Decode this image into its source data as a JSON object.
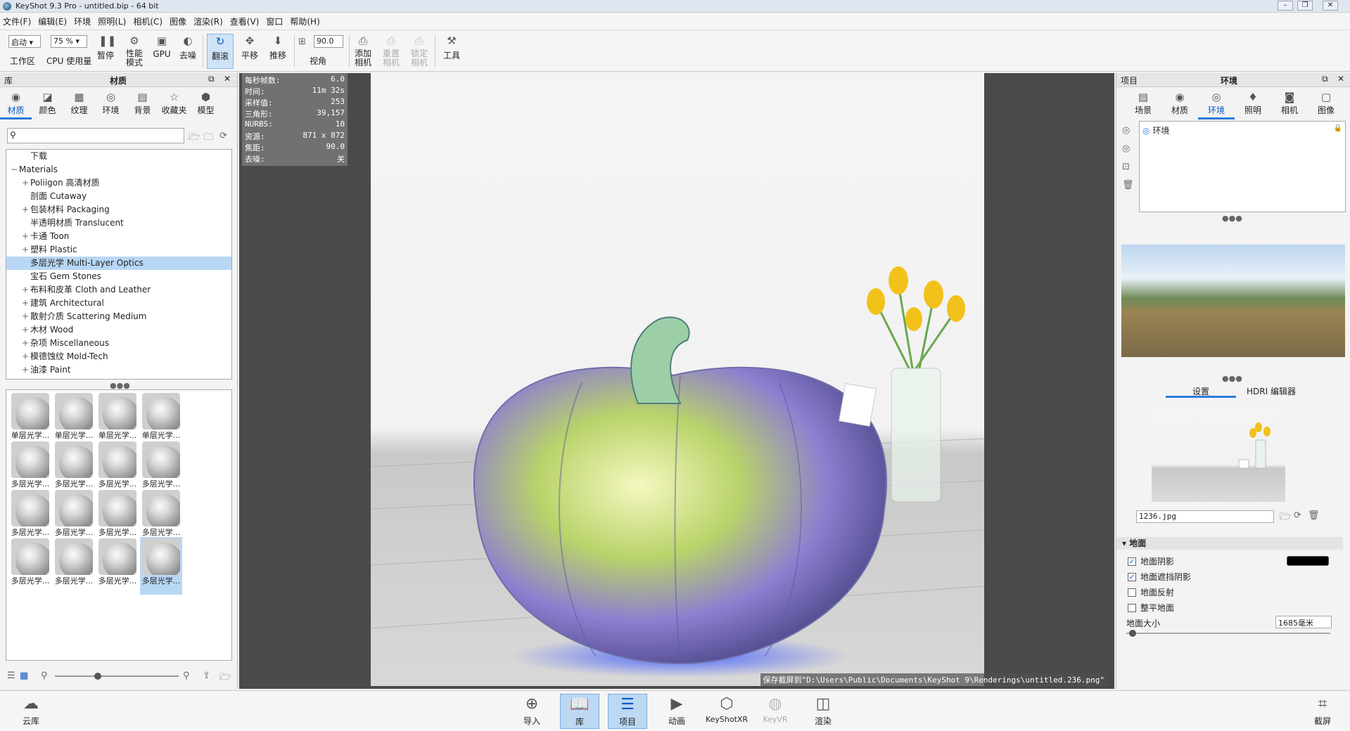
{
  "window": {
    "title": "KeyShot 9.3 Pro  - untitled.bip  - 64 bit"
  },
  "menu": [
    "文件(F)",
    "编辑(E)",
    "环境",
    "照明(L)",
    "相机(C)",
    "图像",
    "渲染(R)",
    "查看(V)",
    "窗口",
    "帮助(H)"
  ],
  "toolbar": {
    "workspace_value": "启动",
    "workspace_label": "工作区",
    "cpu_value": "75 %",
    "cpu_label": "CPU 使用量",
    "pause_label": "暂停",
    "perf_label": "性能\n模式",
    "gpu_label": "GPU",
    "denoise_label": "去噪",
    "tumble_label": "翻滚",
    "pan_label": "平移",
    "dolly_label": "推移",
    "fov_value": "90.0",
    "fov_label": "视角",
    "add_camera_label": "添加\n相机",
    "reset_camera_label": "重置\n相机",
    "lock_camera_label": "锁定\n相机",
    "tools_label": "工具"
  },
  "library": {
    "header_left": "库",
    "header_title": "材质",
    "tabs": [
      {
        "label": "材质",
        "icon": "material-icon"
      },
      {
        "label": "颜色",
        "icon": "color-icon"
      },
      {
        "label": "纹理",
        "icon": "texture-icon"
      },
      {
        "label": "环境",
        "icon": "environment-icon"
      },
      {
        "label": "背景",
        "icon": "background-icon"
      },
      {
        "label": "收藏夹",
        "icon": "favorites-icon"
      },
      {
        "label": "模型",
        "icon": "model-icon"
      }
    ],
    "tree": [
      {
        "label": "下载",
        "indent": 1,
        "exp": ""
      },
      {
        "label": "Materials",
        "indent": 0,
        "exp": "−"
      },
      {
        "label": "Poliigon 高清材质",
        "indent": 1,
        "exp": "+"
      },
      {
        "label": "剖面 Cutaway",
        "indent": 1,
        "exp": ""
      },
      {
        "label": "包装材料 Packaging",
        "indent": 1,
        "exp": "+"
      },
      {
        "label": "半透明材质 Translucent",
        "indent": 1,
        "exp": ""
      },
      {
        "label": "卡通 Toon",
        "indent": 1,
        "exp": "+"
      },
      {
        "label": "塑料 Plastic",
        "indent": 1,
        "exp": "+"
      },
      {
        "label": "多层光学 Multi-Layer Optics",
        "indent": 1,
        "exp": "",
        "selected": true
      },
      {
        "label": "宝石 Gem Stones",
        "indent": 1,
        "exp": ""
      },
      {
        "label": "布料和皮革 Cloth and Leather",
        "indent": 1,
        "exp": "+"
      },
      {
        "label": "建筑 Architectural",
        "indent": 1,
        "exp": "+"
      },
      {
        "label": "散射介质 Scattering Medium",
        "indent": 1,
        "exp": "+"
      },
      {
        "label": "木材 Wood",
        "indent": 1,
        "exp": "+"
      },
      {
        "label": "杂项 Miscellaneous",
        "indent": 1,
        "exp": "+"
      },
      {
        "label": "模德蚀纹 Mold-Tech",
        "indent": 1,
        "exp": "+"
      },
      {
        "label": "油漆 Paint",
        "indent": 1,
        "exp": "+"
      }
    ],
    "thumbs": [
      "单层光学...",
      "单层光学...",
      "单层光学...",
      "单层光学...",
      "多层光学...",
      "多层光学...",
      "多层光学...",
      "多层光学...",
      "多层光学...",
      "多层光学...",
      "多层光学...",
      "多层光学...",
      "多层光学...",
      "多层光学...",
      "多层光学...",
      "多层光学..."
    ]
  },
  "stats": [
    {
      "k": "每秒帧数:",
      "v": "6.0"
    },
    {
      "k": "时间:",
      "v": "11m 32s"
    },
    {
      "k": "采样值:",
      "v": "253"
    },
    {
      "k": "三角形:",
      "v": "39,157"
    },
    {
      "k": "NURBS:",
      "v": "10"
    },
    {
      "k": "资源:",
      "v": "871 x 872"
    },
    {
      "k": "焦距:",
      "v": "90.0"
    },
    {
      "k": "去噪:",
      "v": "关"
    }
  ],
  "viewport": {
    "save_message": "保存截屏到\"D:\\Users\\Public\\Documents\\KeyShot 9\\Renderings\\untitled.236.png\""
  },
  "project": {
    "header_left": "项目",
    "header_title": "环境",
    "tabs": [
      {
        "label": "场景",
        "icon": "scene-icon"
      },
      {
        "label": "材质",
        "icon": "material-icon"
      },
      {
        "label": "环境",
        "icon": "environment-icon"
      },
      {
        "label": "照明",
        "icon": "lighting-icon"
      },
      {
        "label": "相机",
        "icon": "camera-icon"
      },
      {
        "label": "图像",
        "icon": "image-icon"
      }
    ],
    "env_item": "环境",
    "subtab_settings": "设置",
    "subtab_hdri": "HDRI 编辑器",
    "file_name": "1236.jpg",
    "ground_header": "地面",
    "ground_shadow": "地面阴影",
    "ground_occlusion": "地面遮挡阴影",
    "ground_reflection": "地面反射",
    "flat_ground": "整平地面",
    "ground_size_label": "地面大小",
    "ground_size_value": "1685毫米",
    "shadow_color": "#000000"
  },
  "bottombar": {
    "cloud_library": "云库",
    "import": "导入",
    "library": "库",
    "project": "项目",
    "animation": "动画",
    "keyshotxr": "KeyShotXR",
    "keyvr": "KeyVR",
    "render": "渲染",
    "screenshot": "截屏"
  }
}
